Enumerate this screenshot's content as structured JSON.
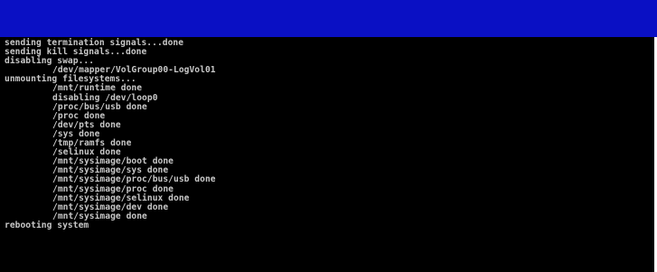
{
  "colors": {
    "title_bar": "#0a10c4",
    "console_background": "#000000",
    "console_text": "#c8c8c8"
  },
  "console": {
    "lines": [
      {
        "text": "sending termination signals...done",
        "indent": false
      },
      {
        "text": "sending kill signals...done",
        "indent": false
      },
      {
        "text": "disabling swap...",
        "indent": false
      },
      {
        "text": "/dev/mapper/VolGroup00-LogVol01",
        "indent": true
      },
      {
        "text": "unmounting filesystems...",
        "indent": false
      },
      {
        "text": "/mnt/runtime done",
        "indent": true
      },
      {
        "text": "disabling /dev/loop0",
        "indent": true
      },
      {
        "text": "/proc/bus/usb done",
        "indent": true
      },
      {
        "text": "/proc done",
        "indent": true
      },
      {
        "text": "/dev/pts done",
        "indent": true
      },
      {
        "text": "/sys done",
        "indent": true
      },
      {
        "text": "/tmp/ramfs done",
        "indent": true
      },
      {
        "text": "/selinux done",
        "indent": true
      },
      {
        "text": "/mnt/sysimage/boot done",
        "indent": true
      },
      {
        "text": "/mnt/sysimage/sys done",
        "indent": true
      },
      {
        "text": "/mnt/sysimage/proc/bus/usb done",
        "indent": true
      },
      {
        "text": "/mnt/sysimage/proc done",
        "indent": true
      },
      {
        "text": "/mnt/sysimage/selinux done",
        "indent": true
      },
      {
        "text": "/mnt/sysimage/dev done",
        "indent": true
      },
      {
        "text": "/mnt/sysimage done",
        "indent": true
      },
      {
        "text": "rebooting system",
        "indent": false
      }
    ]
  }
}
